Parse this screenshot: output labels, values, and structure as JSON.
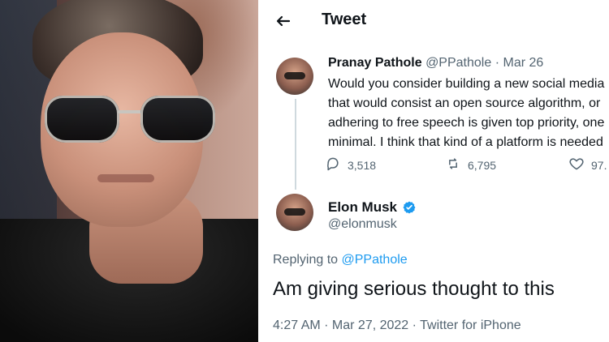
{
  "header": {
    "title": "Tweet"
  },
  "reply_tweet": {
    "name": "Pranay Pathole",
    "handle": "@PPathole",
    "dot": "·",
    "date": "Mar 26",
    "lines": [
      "Would you consider building a new social media",
      "that would consist an open source algorithm, or",
      "adhering to free speech is given top priority, one",
      "minimal. I think that kind of a platform is needed"
    ],
    "metrics": {
      "replies": "3,518",
      "retweets": "6,795",
      "likes": "97."
    }
  },
  "main_tweet": {
    "name": "Elon Musk",
    "handle": "@elonmusk",
    "replying_prefix": "Replying to",
    "replying_handle": "@PPathole",
    "text": "Am giving serious thought to this",
    "timestamp": "4:27 AM · Mar 27, 2022 · Twitter for iPhone"
  },
  "icons": {
    "back": "arrow-left-icon",
    "reply": "reply-icon",
    "retweet": "retweet-icon",
    "like": "heart-icon",
    "verified": "verified-badge-icon"
  },
  "colors": {
    "text_primary": "#0f1419",
    "text_secondary": "#536471",
    "link": "#1d9bf0",
    "thread_line": "#cfd9de"
  }
}
